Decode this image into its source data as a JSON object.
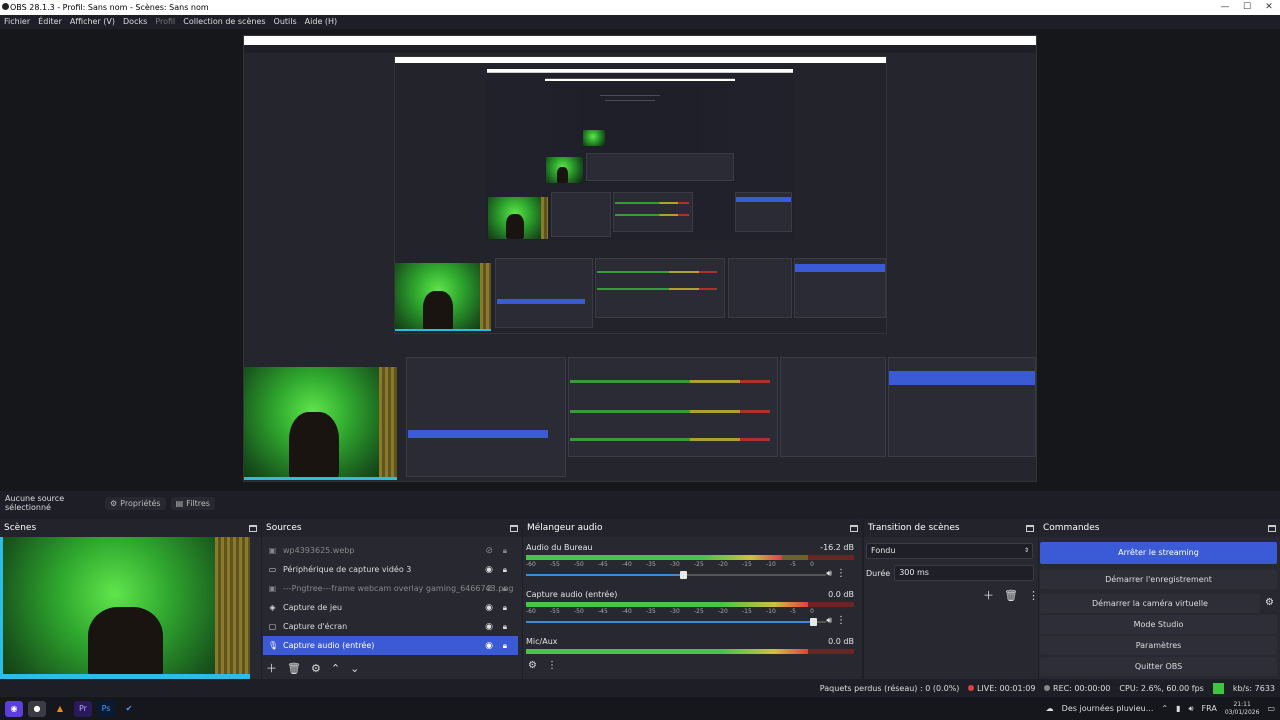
{
  "window": {
    "title": "OBS 28.1.3 - Profil: Sans nom - Scènes: Sans nom",
    "min": "—",
    "max": "☐",
    "close": "✕"
  },
  "menu": [
    "Fichier",
    "Éditer",
    "Afficher (V)",
    "Docks",
    "Profil",
    "Collection de scènes",
    "Outils",
    "Aide (H)"
  ],
  "toolbar": {
    "no_source": "Aucune source sélectionné",
    "properties": "Propriétés",
    "filters": "Filtres"
  },
  "docks": {
    "scenes": "Scènes",
    "sources": "Sources",
    "mixer": "Mélangeur audio",
    "transitions": "Transition de scènes",
    "commands": "Commandes"
  },
  "sources": [
    {
      "label": "wp4393625.webp",
      "icon": "image-icon",
      "dim": true
    },
    {
      "label": "Périphérique de capture vidéo 3",
      "icon": "camera-icon",
      "dim": false
    },
    {
      "label": "---Pngtree---frame webcam overlay gaming_6466743.png",
      "icon": "image-icon",
      "dim": true
    },
    {
      "label": "Capture de jeu",
      "icon": "gamepad-icon",
      "dim": false
    },
    {
      "label": "Capture d'écran",
      "icon": "monitor-icon",
      "dim": false
    },
    {
      "label": "Capture audio (entrée)",
      "icon": "mic-icon",
      "dim": false,
      "selected": true
    }
  ],
  "mixer": {
    "ticks": [
      "-60",
      "-55",
      "-50",
      "-45",
      "-40",
      "-35",
      "-30",
      "-25",
      "-20",
      "-15",
      "-10",
      "-5",
      "0"
    ],
    "channels": [
      {
        "name": "Audio du Bureau",
        "db": "-16.2 dB",
        "level": 0.78,
        "volume": 0.53
      },
      {
        "name": "Capture audio (entrée)",
        "db": "0.0 dB",
        "level": 0.86,
        "volume": 0.98
      },
      {
        "name": "Mic/Aux",
        "db": "0.0 dB",
        "level": 0.86,
        "volume": 1.0
      }
    ]
  },
  "transitions": {
    "type": "Fondu",
    "duration_label": "Durée",
    "duration": "300 ms"
  },
  "commands": [
    "Arrêter le streaming",
    "Démarrer l'enregistrement",
    "Démarrer la caméra virtuelle",
    "Mode Studio",
    "Paramètres",
    "Quitter OBS"
  ],
  "status": {
    "dropped": "Paquets perdus (réseau) : 0 (0.0%)",
    "live": "LIVE: 00:01:09",
    "rec": "REC: 00:00:00",
    "cpu": "CPU: 2.6%, 60.00 fps",
    "kbps": "kb/s: 7633"
  },
  "taskbar": {
    "news": "Des journées pluvieu...",
    "lang": "FRA",
    "time": "21:11",
    "date": "03/01/2026"
  }
}
